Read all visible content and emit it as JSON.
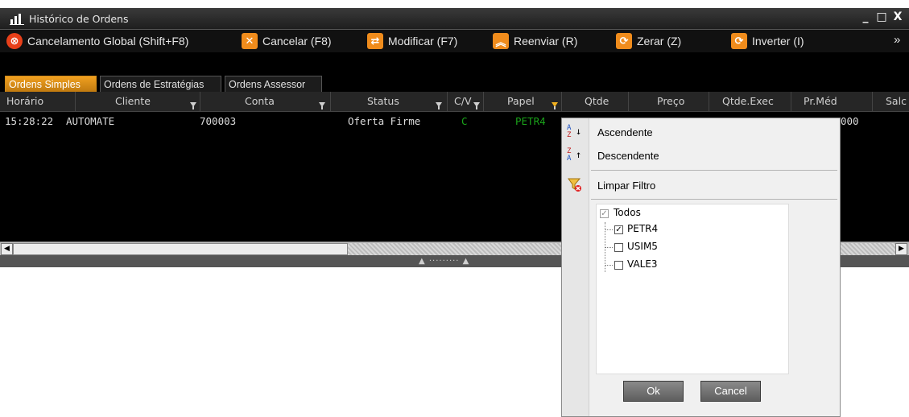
{
  "window": {
    "title": "Histórico de Ordens",
    "controls": {
      "minimize": "_",
      "maximize": "□",
      "close": "X"
    }
  },
  "toolbar": {
    "items": [
      {
        "label": "Cancelamento Global (Shift+F8)",
        "icon": "cancel-global-icon",
        "color": "#e8401a"
      },
      {
        "label": "Cancelar (F8)",
        "icon": "x-icon",
        "color": "#f08c1c"
      },
      {
        "label": "Modificar (F7)",
        "icon": "modify-icon",
        "color": "#f08c1c"
      },
      {
        "label": "Reenviar (R)",
        "icon": "double-chevron-up-icon",
        "color": "#f08c1c"
      },
      {
        "label": "Zerar (Z)",
        "icon": "refresh-icon",
        "color": "#f08c1c"
      },
      {
        "label": "Inverter (I)",
        "icon": "refresh-icon",
        "color": "#f08c1c"
      }
    ],
    "overflow": "»"
  },
  "tabs": [
    {
      "label": "Ordens Simples",
      "active": true
    },
    {
      "label": "Ordens de Estratégias",
      "active": false
    },
    {
      "label": "Ordens Assessor",
      "active": false
    }
  ],
  "columns": [
    "Horário",
    "Cliente",
    "Conta",
    "Status",
    "C/V",
    "Papel",
    "Qtde",
    "Preço",
    "Qtde.Exec",
    "Pr.Méd",
    "Salc"
  ],
  "rows": [
    {
      "horario": "15:28:22",
      "cliente": "AUTOMATE",
      "conta": "700003",
      "status": "Oferta Firme",
      "cv": "C",
      "papel": "PETR4",
      "prmed_partial": "000"
    }
  ],
  "footer": {
    "splitter": "▲ ········· ▲"
  },
  "filter_menu": {
    "sort_asc": "Ascendente",
    "sort_desc": "Descendente",
    "clear_filter": "Limpar Filtro",
    "values": [
      {
        "label": "Todos",
        "checked": true,
        "disabled": true
      },
      {
        "label": "PETR4",
        "checked": true
      },
      {
        "label": "USIM5",
        "checked": false
      },
      {
        "label": "VALE3",
        "checked": false
      }
    ],
    "ok_label": "Ok",
    "cancel_label": "Cancel"
  },
  "colors": {
    "accent": "#f0a020",
    "green": "#1aa31a"
  }
}
